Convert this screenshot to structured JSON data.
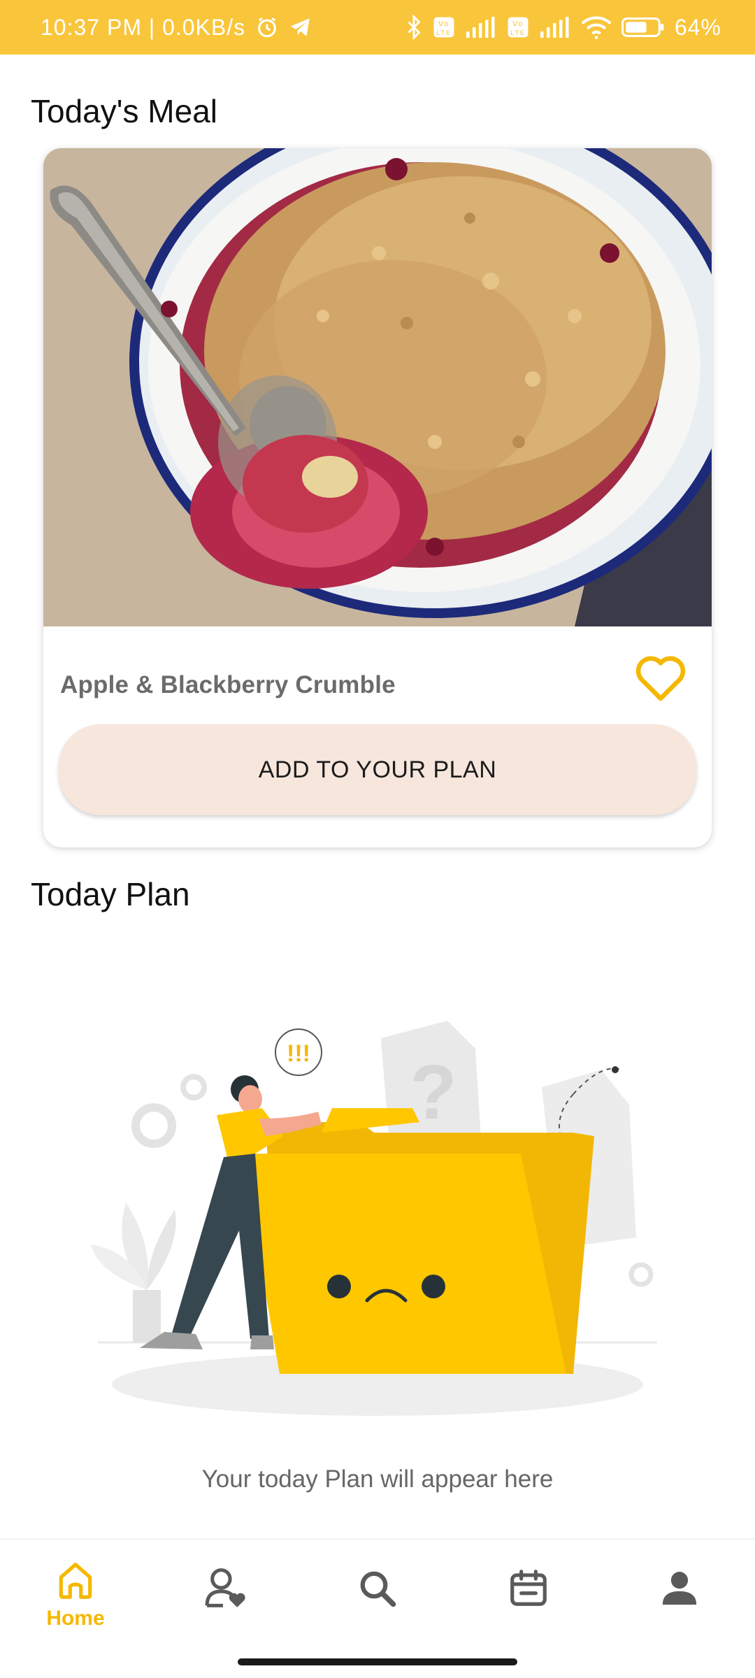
{
  "status_bar": {
    "time_and_speed": "10:37 PM | 0.0KB/s",
    "battery_percent": "64%",
    "icons": [
      "alarm-icon",
      "telegram-icon",
      "bluetooth-icon",
      "volte-icon",
      "signal-icon",
      "volte-icon",
      "signal-icon",
      "wifi-icon",
      "battery-icon"
    ]
  },
  "todays_meal": {
    "title": "Today's Meal",
    "meal_name": "Apple & Blackberry Crumble",
    "favorite_icon": "heart-outline-icon",
    "add_button_label": "ADD TO YOUR PLAN"
  },
  "today_plan": {
    "title": "Today Plan",
    "empty_message": "Your today Plan will appear here",
    "illustration_bubble_text": "!!!"
  },
  "bottom_nav": {
    "items": [
      {
        "label": "Home",
        "icon": "home-icon",
        "active": true
      },
      {
        "label": "",
        "icon": "favorite-person-icon",
        "active": false
      },
      {
        "label": "",
        "icon": "search-icon",
        "active": false
      },
      {
        "label": "",
        "icon": "calendar-icon",
        "active": false
      },
      {
        "label": "",
        "icon": "profile-icon",
        "active": false
      }
    ]
  },
  "colors": {
    "accent": "#f9c53b",
    "active_nav": "#f5b800",
    "button_bg": "#f6e6dc",
    "icon_gray": "#5a5a5a"
  }
}
